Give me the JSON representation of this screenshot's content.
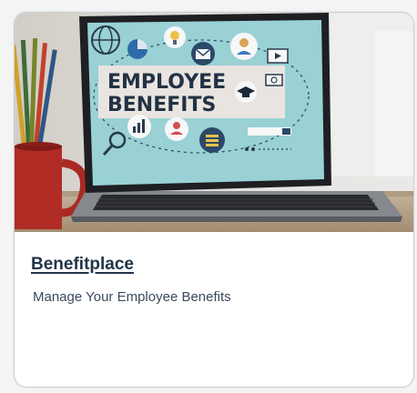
{
  "card": {
    "title": "Benefitplace",
    "subtitle": "Manage Your Employee Benefits",
    "image": {
      "screen_line1": "EMPLOYEE",
      "screen_line2": "BENEFITS"
    }
  },
  "colors": {
    "title": "#223548",
    "subtitle": "#3b4a5c",
    "border": "#c9ced6",
    "screen_bg": "#9ed8dc"
  }
}
